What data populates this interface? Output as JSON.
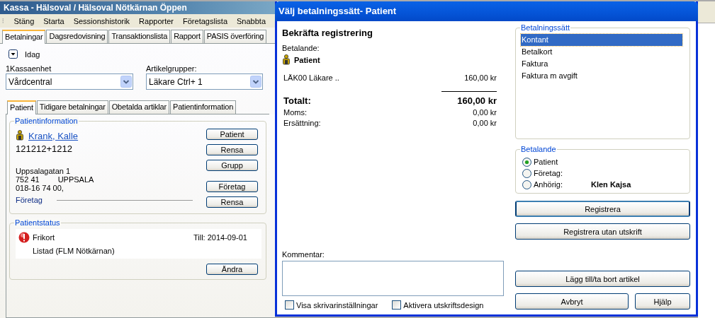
{
  "main_window": {
    "title": "Kassa - Hälsoval / Hälsoval Nötkärnan Öppen",
    "menu": [
      "Stäng",
      "Starta",
      "Sessionshistorik",
      "Rapporter",
      "Företagslista",
      "Snabbta"
    ],
    "tabs": [
      {
        "label": "Betalningar",
        "selected": true
      },
      {
        "label": "Dagsredovisning",
        "selected": false
      },
      {
        "label": "Transaktionslista",
        "selected": false
      },
      {
        "label": "Rapport",
        "selected": false
      },
      {
        "label": "PASIS överföring",
        "selected": false
      }
    ],
    "date_filter": {
      "label": "Idag"
    },
    "kassaenhet": {
      "label": "1Kassaenhet",
      "value": "Vårdcentral"
    },
    "artikelgrupper": {
      "label": "Artikelgrupper:",
      "value": "Läkare Ctrl+ 1"
    },
    "sub_tabs": [
      {
        "label": "Patient",
        "selected": true
      },
      {
        "label": "Tidigare betalningar",
        "selected": false
      },
      {
        "label": "Obetalda artiklar",
        "selected": false
      },
      {
        "label": "Patientinformation",
        "selected": false
      }
    ],
    "patient_info": {
      "title": "Patientinformation",
      "name": "Krank, Kalle",
      "id": "121212+1212",
      "street": "Uppsalagatan 1",
      "postcode": "752 41",
      "city": "UPPSALA",
      "phone": "018-16 74 00,",
      "company_label": "Företag",
      "buttons": [
        "Patient",
        "Rensa",
        "Grupp"
      ],
      "company_buttons": [
        "Företag",
        "Rensa"
      ]
    },
    "patient_status": {
      "title": "Patientstatus",
      "items": [
        {
          "text": "Frikort",
          "date": "Till: 2014-09-01",
          "alert": true
        },
        {
          "text": "Listad (FLM Nötkärnan)",
          "alert": false
        }
      ],
      "button": "Ändra"
    }
  },
  "dialog": {
    "title": "Välj betalningssätt- Patient",
    "heading": "Bekräfta registrering",
    "payer_label": "Betalande:",
    "payer": "Patient",
    "lines": [
      {
        "label": "LÄK00 Läkare ..",
        "amount": "160,00 kr"
      }
    ],
    "total": {
      "label": "Totalt:",
      "amount": "160,00 kr"
    },
    "details": [
      {
        "label": "Moms:",
        "amount": "0,00 kr"
      },
      {
        "label": "Ersättning:",
        "amount": "0,00 kr"
      }
    ],
    "comment": {
      "label": "Kommentar:"
    },
    "checkboxes": [
      {
        "label": "Visa skrivarinställningar",
        "checked": false
      },
      {
        "label": "Aktivera utskriftsdesign",
        "checked": false
      }
    ],
    "payment_methods": {
      "title": "Betalningssätt",
      "items": [
        {
          "label": "Kontant",
          "selected": true
        },
        {
          "label": "Betalkort",
          "selected": false
        },
        {
          "label": "Faktura",
          "selected": false
        },
        {
          "label": "Faktura m avgift",
          "selected": false
        }
      ]
    },
    "payer_group": {
      "title": "Betalande",
      "options": [
        {
          "label": "Patient",
          "selected": true
        },
        {
          "label": "Företag:",
          "selected": false
        },
        {
          "label": "Anhörig:",
          "selected": false,
          "value": "Klen Kajsa"
        }
      ]
    },
    "buttons": [
      {
        "label": "Registrera",
        "kind": "wide"
      },
      {
        "label": "Registrera utan utskrift",
        "kind": "wide"
      },
      {
        "label": "Lägg till/ta bort artikel",
        "kind": "wide"
      },
      {
        "label": "Avbryt",
        "kind": "half"
      },
      {
        "label": "Hjälp",
        "kind": "small"
      }
    ]
  }
}
